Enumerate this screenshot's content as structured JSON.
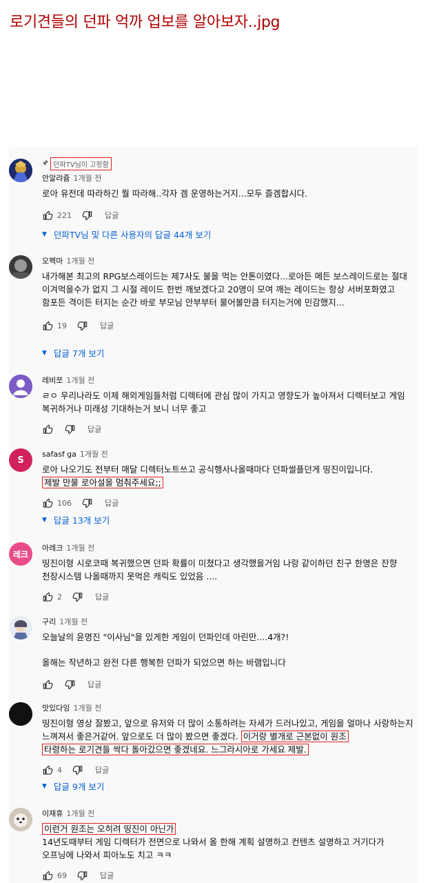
{
  "post": {
    "title": "로기견들의 던파 억까 업보를 알아보자..jpg"
  },
  "common": {
    "reply_label": "답글"
  },
  "comments": [
    {
      "pinned_label": "던파TV님이 고정함",
      "author": "안알랴쥼",
      "time": "1개월 전",
      "text": "로아 유전데 따라하긴 뭘 따라해..각자 겜 운영하는거지...모두 즐겜합시다.",
      "likes": "221",
      "more_replies": "던파TV님 및 다른 사용자의 답글 44개 보기"
    },
    {
      "author": "오펙마",
      "time": "1개월 전",
      "text": "내가해본 최고의 RPG보스레이드는 제7사도 불을 먹는 안톤이였다...로아든 메든 보스레이드로는 절대 이겨먹을수가 없지 그 시절 레이드 한번 깨보겠다고 20명이 모여 깨는 레이드는 항상 서버포화였고 함포든 격이든 터지는 순간 바로 부모님 안부부터 물어볼만큼 터지는거에 민감했지...",
      "likes": "19",
      "more_replies": "답글 7개 보기"
    },
    {
      "author": "레비쪼",
      "time": "1개월 전",
      "text": "ㄹㅇ 우리나라도 이제 해외게임들처럼 디렉터에 관심 많이 가지고 영향도가 높아져서 디렉터보고 게임 복귀하거나 미래성 기대하는거 보니 너무 좋고",
      "likes": ""
    },
    {
      "avatar_letter": "S",
      "author": "safasf ga",
      "time": "1개월 전",
      "text": "로아 나오기도 전부터 매달 디렉터노트쓰고 공식행사나올때마다 던파썰플던게 띵진이입니다.",
      "highlight": "제발 만물 로아설을 멈춰주세요;;",
      "likes": "106",
      "more_replies": "답글 13개 보기"
    },
    {
      "avatar_letter": "레크",
      "author": "아레크",
      "time": "1개월 전",
      "text": "띵진이형 시로코때 복귀했으면 던파 확률이 미쳤다고 생각했을거임 나랑 같이하던 친구 한명은 잔향 천장시스템 나올때까지 못먹은 캐릭도 있었음 ....",
      "likes": "2"
    },
    {
      "author": "구리",
      "time": "1개월 전",
      "text": "오늘날의 윤명진 \"이사님\"을 있게한 게임이 던파인데 아린만....4개?!",
      "text2": "올해는 작년하고 완전 다른 행복한 던파가 되었으면 하는 바램입니다",
      "likes": ""
    },
    {
      "author": "맛있다잉",
      "time": "1개월 전",
      "text": "띵진이형 영상 잘봤고, 앞으로 유저와 더 많이 소통하려는 자세가 드러나있고, 게임을 얼마나 사랑하는지 느껴져서 좋은거같어. 앞으로도 더 많이 봤으면 좋겠다.",
      "highlight": "이거랑 별개로 근본없이 원조",
      "highlight2": "타령하는 로기견들 싹다 돌아갔으면 좋겠네요. 느그라시아로 가세요 제발.",
      "likes": "4",
      "more_replies": "답글 9개 보기"
    },
    {
      "author": "이재휴",
      "time": "1개월 전",
      "highlight": "이런거 원조는 오히려 띵진이 아닌가",
      "text": "14년도때부터 게임 디렉터가 전면으로 나와서 올 한해 계획 설명하고 컨텐츠 설명하고 거기다가 오프닝에 나와서 피아노도 치고 ㅋㅋ",
      "likes": "69"
    }
  ],
  "colors": {
    "highlight_box": "#e02020",
    "link": "#065fd4",
    "title": "#b00000",
    "panel": "#f9f9f9"
  }
}
